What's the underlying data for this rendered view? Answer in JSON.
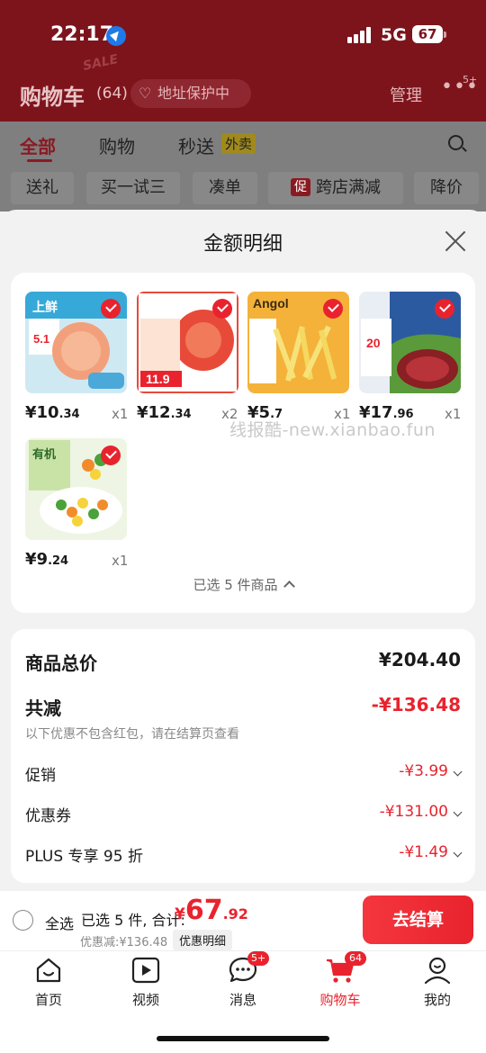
{
  "status_bar": {
    "time": "22:17",
    "network": "5G",
    "battery": "67"
  },
  "header": {
    "title": "购物车",
    "count": "(64)",
    "address_protect": "地址保护中",
    "manage": "管理",
    "more_badge": "5+",
    "sale_decor": "SALE"
  },
  "tabs": [
    {
      "label": "全部",
      "active": true
    },
    {
      "label": "购物"
    },
    {
      "label": "秒送"
    }
  ],
  "tabs_waimai": "外卖",
  "filters": [
    "送礼",
    "买一试三",
    "凑单",
    "跨店满减",
    "降价"
  ],
  "filter_badge": "促",
  "sheet": {
    "title": "金额明细",
    "watermark": "线报酷-new.xianbao.fun",
    "products": [
      {
        "price_int": "¥10",
        "price_dec": ".34",
        "qty": "x1",
        "img_label": "上鲜",
        "accent": "#8dd0e8"
      },
      {
        "price_int": "¥12",
        "price_dec": ".34",
        "qty": "x2",
        "img_label": "11.9",
        "accent": "#e84a3a"
      },
      {
        "price_int": "¥5",
        "price_dec": ".7",
        "qty": "x1",
        "img_label": "Angol",
        "accent": "#f4b23a"
      },
      {
        "price_int": "¥17",
        "price_dec": ".96",
        "qty": "x1",
        "img_label": "20",
        "accent": "#2c5aa0"
      },
      {
        "price_int": "¥9",
        "price_dec": ".24",
        "qty": "x1",
        "img_label": "有机",
        "accent": "#9ccf5a"
      }
    ],
    "selected_text": "已选 5 件商品",
    "summary": {
      "total_label": "商品总价",
      "total_value": "¥204.40",
      "reduce_label": "共减",
      "reduce_value": "-¥136.48",
      "note": "以下优惠不包含红包，请在结算页查看",
      "lines": [
        {
          "label": "促销",
          "value": "-¥3.99"
        },
        {
          "label": "优惠券",
          "value": "-¥131.00"
        },
        {
          "label": "PLUS 专享 95 折",
          "value": "-¥1.49"
        }
      ]
    }
  },
  "checkout": {
    "select_all": "全选",
    "selected": "已选 5 件, 合计:",
    "currency": "¥",
    "amount_int": "67",
    "amount_dec": ".92",
    "discount": "优惠减:¥136.48",
    "detail_button": "优惠明细",
    "pay_button": "去结算"
  },
  "tabbar": [
    {
      "label": "首页",
      "icon": "home-icon"
    },
    {
      "label": "视频",
      "icon": "video-icon"
    },
    {
      "label": "消息",
      "icon": "message-icon",
      "badge": "5+"
    },
    {
      "label": "购物车",
      "icon": "cart-icon",
      "badge": "64",
      "active": true
    },
    {
      "label": "我的",
      "icon": "profile-icon"
    }
  ],
  "colors": {
    "brand_red": "#e8232e",
    "header_dim": "#7d141c"
  }
}
